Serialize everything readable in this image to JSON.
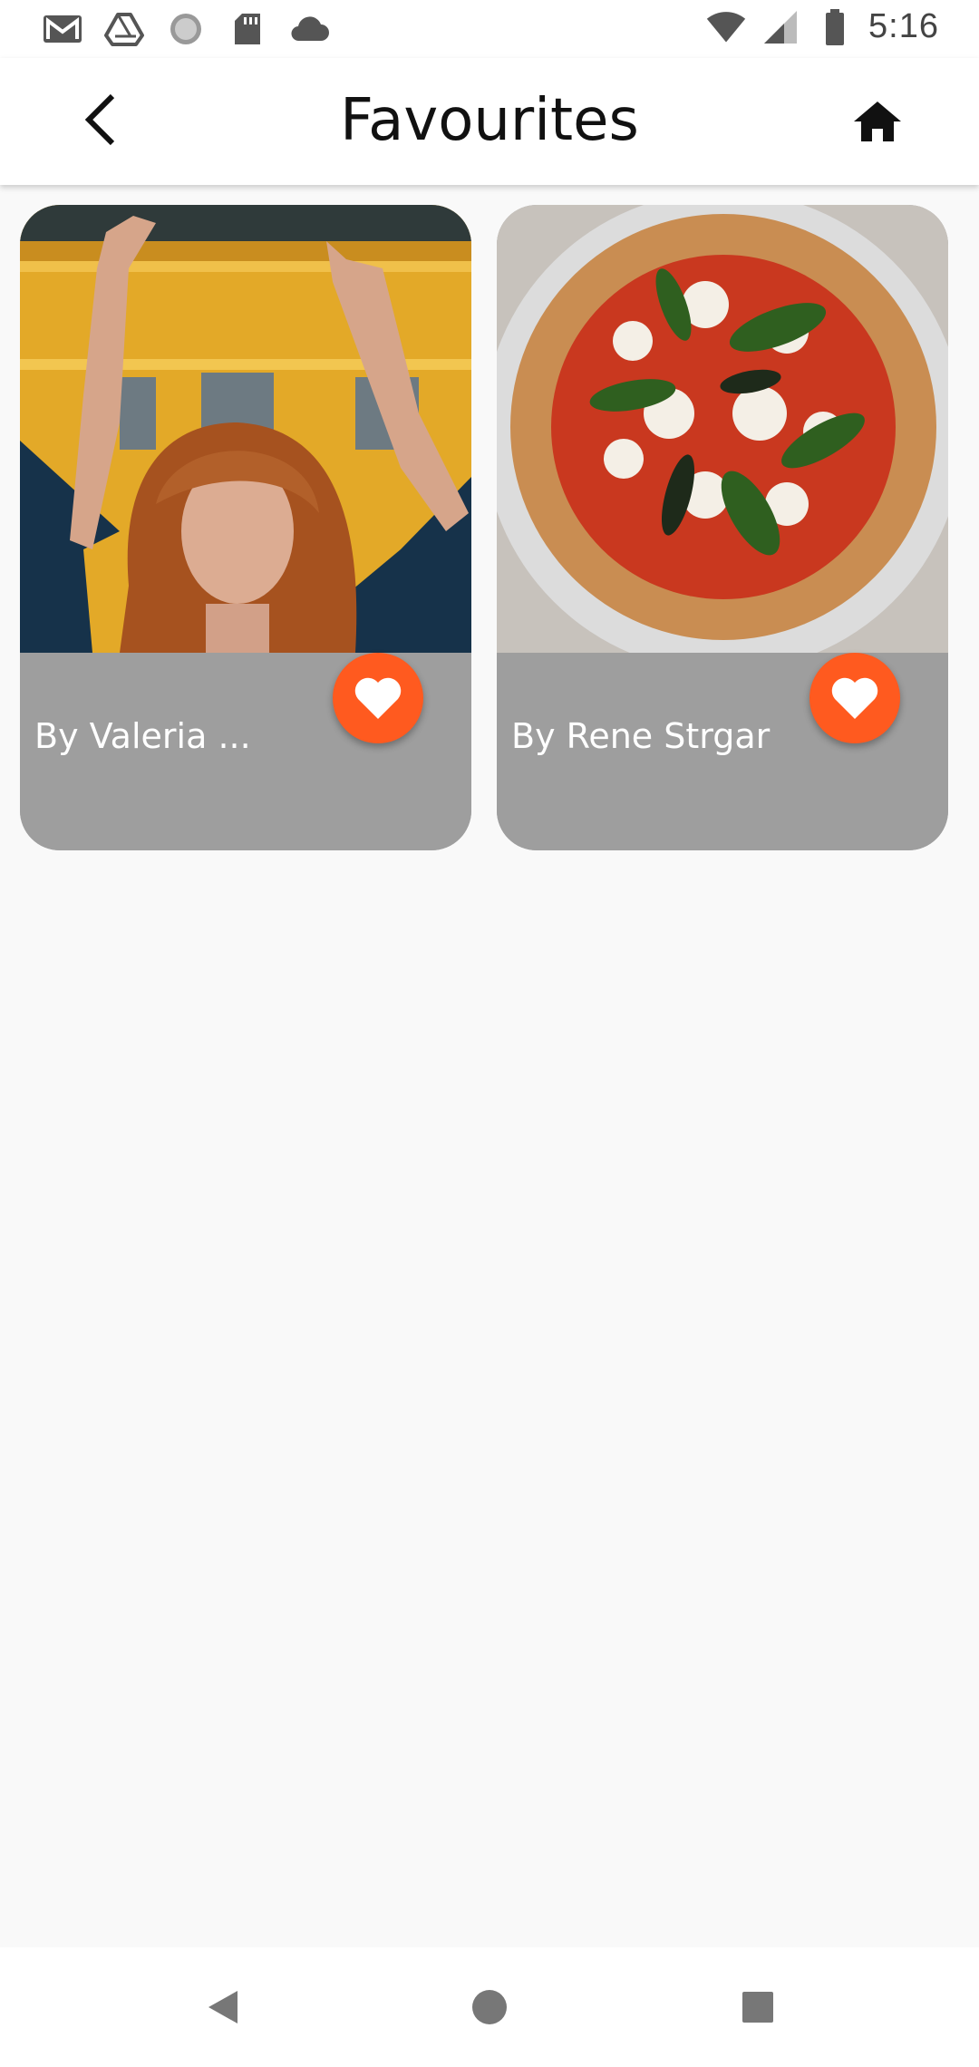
{
  "status_bar": {
    "time": "5:16",
    "left_icons": [
      "gmail-icon",
      "drive-icon",
      "sync-icon",
      "sd-card-icon",
      "cloud-icon"
    ],
    "right_icons": [
      "wifi-icon",
      "signal-icon",
      "battery-icon"
    ]
  },
  "app_bar": {
    "title": "Favourites",
    "back_icon": "chevron-left-icon",
    "home_icon": "home-icon"
  },
  "favourites": [
    {
      "author": "By Valeria ...",
      "image": "woman-raising-hands-photo",
      "favourite_icon": "heart-icon"
    },
    {
      "author": "By Rene Strgar",
      "image": "margherita-pizza-photo",
      "favourite_icon": "heart-icon"
    }
  ],
  "colors": {
    "accent": "#ff5a1f",
    "card_footer": "#9e9e9e",
    "background": "#f9f9f9"
  },
  "nav_bar": {
    "buttons": [
      "back-triangle-icon",
      "home-circle-icon",
      "recents-square-icon"
    ]
  }
}
